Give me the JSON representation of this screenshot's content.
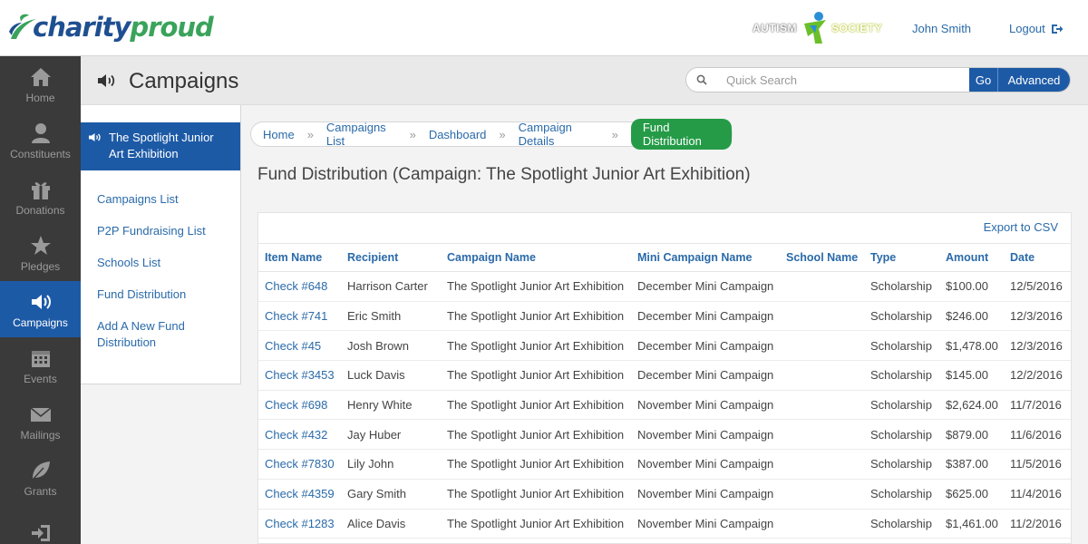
{
  "brand": {
    "logo_part1": "charity",
    "logo_part2": "proud"
  },
  "partner": {
    "word1": "AUTISM",
    "word2": "SOCIETY"
  },
  "user": {
    "name": "John Smith",
    "logout_label": "Logout"
  },
  "rail": [
    {
      "label": "Home",
      "icon": "home-icon"
    },
    {
      "label": "Constituents",
      "icon": "person-icon"
    },
    {
      "label": "Donations",
      "icon": "gift-icon"
    },
    {
      "label": "Pledges",
      "icon": "star-icon"
    },
    {
      "label": "Campaigns",
      "icon": "megaphone-icon",
      "active": true
    },
    {
      "label": "Events",
      "icon": "calendar-icon"
    },
    {
      "label": "Mailings",
      "icon": "envelope-icon"
    },
    {
      "label": "Grants",
      "icon": "leaf-icon"
    },
    {
      "label": "",
      "icon": "sign-in-icon"
    }
  ],
  "header": {
    "title": "Campaigns",
    "search_placeholder": "Quick Search",
    "go_label": "Go",
    "advanced_label": "Advanced"
  },
  "subnav": {
    "active_title": "The Spotlight Junior Art Exhibition",
    "links": [
      "Campaigns List",
      "P2P Fundraising List",
      "Schools List",
      "Fund Distribution",
      "Add A New Fund Distribution"
    ]
  },
  "breadcrumb": {
    "items": [
      "Home",
      "Campaigns List",
      "Dashboard",
      "Campaign Details"
    ],
    "separator": "»",
    "active": "Fund Distribution"
  },
  "main": {
    "heading": "Fund Distribution (Campaign: The Spotlight Junior Art Exhibition)",
    "export_label": "Export to CSV"
  },
  "table": {
    "columns": [
      "Item Name",
      "Recipient",
      "Campaign Name",
      "Mini Campaign Name",
      "School Name",
      "Type",
      "Amount",
      "Date"
    ],
    "rows": [
      [
        "Check #648",
        "Harrison Carter",
        "The Spotlight Junior Art Exhibition",
        "December Mini Campaign",
        "",
        "Scholarship",
        "$100.00",
        "12/5/2016"
      ],
      [
        "Check #741",
        "Eric Smith",
        "The Spotlight Junior Art Exhibition",
        "December Mini Campaign",
        "",
        "Scholarship",
        "$246.00",
        "12/3/2016"
      ],
      [
        "Check #45",
        "Josh Brown",
        "The Spotlight Junior Art Exhibition",
        "December Mini Campaign",
        "",
        "Scholarship",
        "$1,478.00",
        "12/3/2016"
      ],
      [
        "Check #3453",
        "Luck Davis",
        "The Spotlight Junior Art Exhibition",
        "December Mini Campaign",
        "",
        "Scholarship",
        "$145.00",
        "12/2/2016"
      ],
      [
        "Check #698",
        "Henry White",
        "The Spotlight Junior Art Exhibition",
        "November Mini Campaign",
        "",
        "Scholarship",
        "$2,624.00",
        "11/7/2016"
      ],
      [
        "Check #432",
        "Jay Huber",
        "The Spotlight Junior Art Exhibition",
        "November Mini Campaign",
        "",
        "Scholarship",
        "$879.00",
        "11/6/2016"
      ],
      [
        "Check #7830",
        "Lily John",
        "The Spotlight Junior Art Exhibition",
        "November Mini Campaign",
        "",
        "Scholarship",
        "$387.00",
        "11/5/2016"
      ],
      [
        "Check #4359",
        "Gary Smith",
        "The Spotlight Junior Art Exhibition",
        "November Mini Campaign",
        "",
        "Scholarship",
        "$625.00",
        "11/4/2016"
      ],
      [
        "Check #1283",
        "Alice Davis",
        "The Spotlight Junior Art Exhibition",
        "November Mini Campaign",
        "",
        "Scholarship",
        "$1,461.00",
        "11/2/2016"
      ]
    ]
  },
  "colors": {
    "primary": "#1d5aa6",
    "link": "#2a6aa9",
    "success": "#259b48",
    "rail_bg": "#3a3a3a"
  }
}
